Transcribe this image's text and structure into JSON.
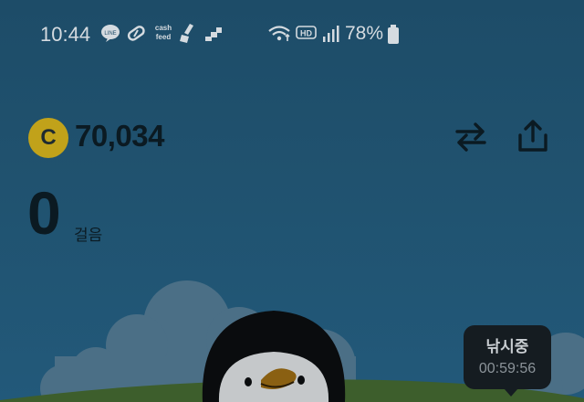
{
  "status_bar": {
    "time": "10:44",
    "notification_icons": [
      "line-app-icon",
      "pill-icon",
      "cash-feed-icon",
      "cleaning-app-icon",
      "stairs-app-icon"
    ],
    "cash_feed_text": "cash feed",
    "system_icons": [
      "wifi-icon",
      "hd-voice-icon",
      "signal-icon"
    ],
    "battery_percent": "78%"
  },
  "points": {
    "coin_letter": "C",
    "value": "70,034"
  },
  "actions": {
    "icons": [
      "swap-icon",
      "share-icon"
    ]
  },
  "steps": {
    "count": "0",
    "unit": "걸음"
  },
  "fishing_badge": {
    "title": "낚시중",
    "timer": "00:59:56"
  },
  "colors": {
    "sky": "#1f5170",
    "coin": "#c1a21a",
    "text_dark": "#0b1a22",
    "badge_bg": "#151c21",
    "grass": "#3d5e2c"
  }
}
